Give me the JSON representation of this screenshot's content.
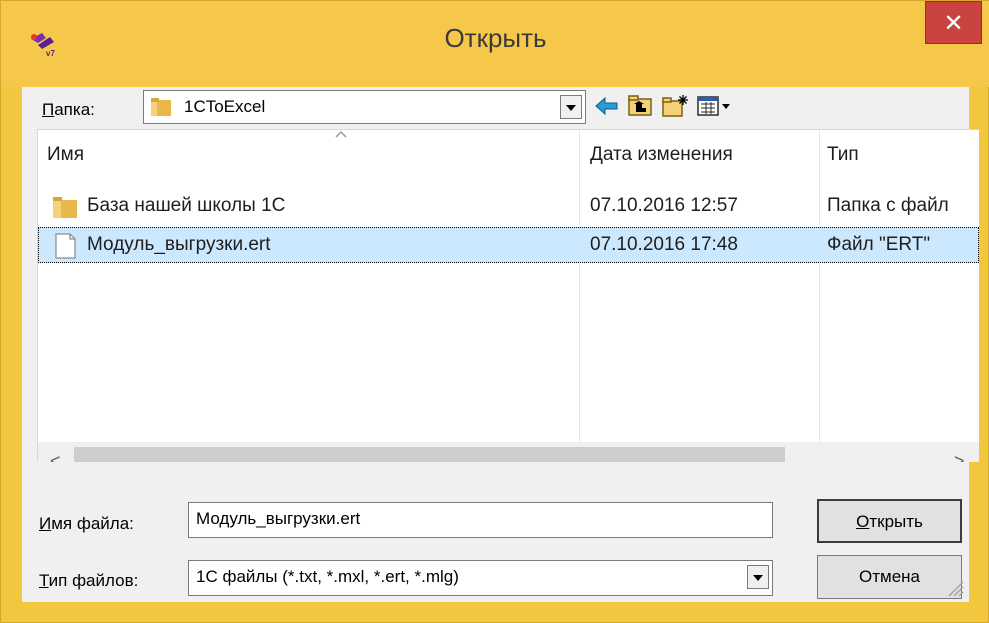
{
  "window": {
    "title": "Открыть",
    "close_glyph": "✕",
    "app_icon": "1c-app-icon"
  },
  "toolbar": {
    "folder_label": "Папка:",
    "folder_label_accel": "П",
    "folder_label_rest": "апка:",
    "current_folder": "1CToExcel",
    "icons": [
      "back-arrow-icon",
      "up-folder-icon",
      "new-folder-icon",
      "view-menu-icon"
    ]
  },
  "filelist": {
    "columns": {
      "name": "Имя",
      "date": "Дата изменения",
      "type": "Тип"
    },
    "rows": [
      {
        "name": "База нашей школы 1С",
        "date": "07.10.2016 12:57",
        "type": "Папка с файл",
        "icon": "folder-icon",
        "selected": false
      },
      {
        "name": "Модуль_выгрузки.ert",
        "date": "07.10.2016 17:48",
        "type": "Файл \"ERT\"",
        "icon": "file-icon",
        "selected": true
      }
    ]
  },
  "scrollbar": {
    "left_glyph": "<",
    "right_glyph": ">"
  },
  "form": {
    "filename_label_accel": "И",
    "filename_label_rest": "мя файла:",
    "filename_value": "Модуль_выгрузки.ert",
    "filetype_label_accel": "Т",
    "filetype_label_rest": "ип файлов:",
    "filetype_value": "1С файлы (*.txt, *.mxl, *.ert, *.mlg)"
  },
  "buttons": {
    "open_accel": "О",
    "open_rest": "ткрыть",
    "cancel": "Отмена"
  },
  "colors": {
    "title_bar": "#f6c84a",
    "close_button": "#c9443f",
    "selection": "#cce8ff"
  }
}
